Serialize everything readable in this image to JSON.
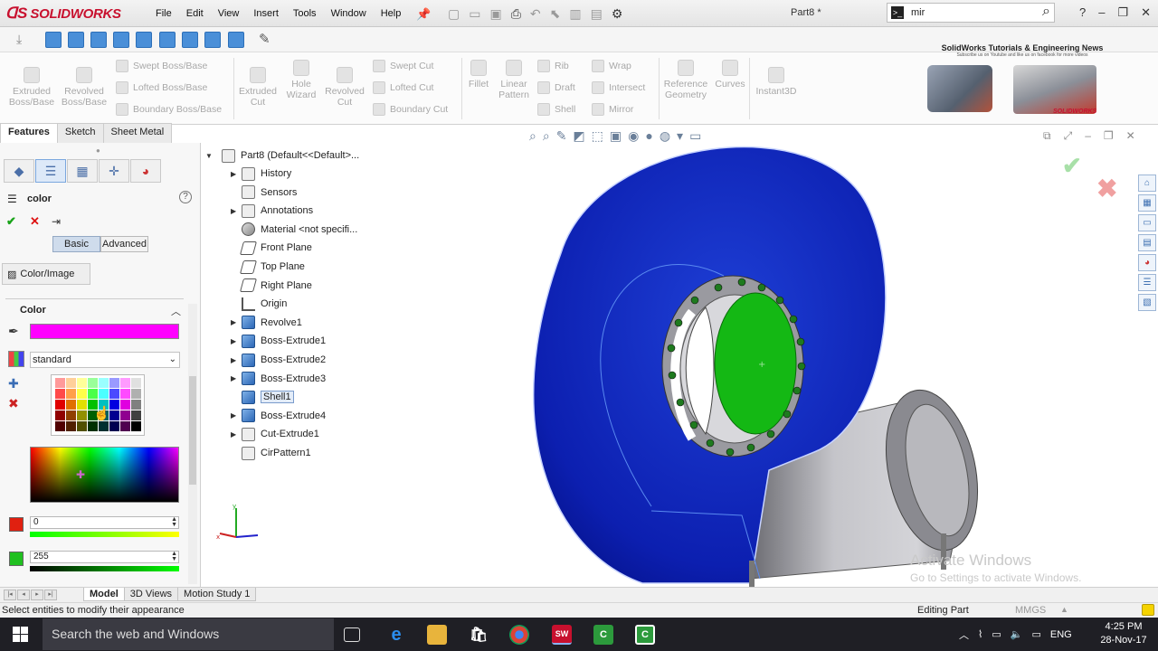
{
  "app": {
    "name": "SOLIDWORKS",
    "doc_title": "Part8 *",
    "menu": [
      "File",
      "Edit",
      "View",
      "Insert",
      "Tools",
      "Window",
      "Help"
    ],
    "search_value": "mir",
    "window_controls": [
      "?",
      "–",
      "❐",
      "✕"
    ]
  },
  "ribbon": {
    "big": [
      "Extruded Boss/Base",
      "Revolved Boss/Base"
    ],
    "boss_list": [
      "Swept Boss/Base",
      "Lofted Boss/Base",
      "Boundary Boss/Base"
    ],
    "cut_big": [
      "Extruded Cut",
      "Hole Wizard",
      "Revolved Cut"
    ],
    "cut_list": [
      "Swept Cut",
      "Lofted Cut",
      "Boundary Cut"
    ],
    "feat_big": [
      "Fillet",
      "Linear Pattern"
    ],
    "feat_list1": [
      "Rib",
      "Draft",
      "Shell"
    ],
    "feat_list2": [
      "Wrap",
      "Intersect",
      "Mirror"
    ],
    "ref": [
      "Reference Geometry",
      "Curves",
      "Instant3D"
    ],
    "news_title": "SolidWorks Tutorials & Engineering News",
    "news_sub": "Subscribe us on Youtube and like us on facebook for more videos",
    "brand_small": "SOLIDWORKS"
  },
  "cmd_tabs": [
    "Features",
    "Sketch",
    "Sheet Metal"
  ],
  "property_manager": {
    "title": "color",
    "modes": [
      "Basic",
      "Advanced"
    ],
    "color_image_tab": "Color/Image",
    "color_group": "Color",
    "selected_color": "#ff00ff",
    "palette": "standard",
    "red_value": "0",
    "green_value": "255"
  },
  "tree": {
    "root": "Part8  (Default<<Default>...",
    "items": [
      "History",
      "Sensors",
      "Annotations",
      "Material <not specifi...",
      "Front Plane",
      "Top Plane",
      "Right Plane",
      "Origin",
      "Revolve1",
      "Boss-Extrude1",
      "Boss-Extrude2",
      "Boss-Extrude3",
      "Shell1",
      "Boss-Extrude4",
      "Cut-Extrude1",
      "CirPattern1"
    ]
  },
  "bottom_tabs": [
    "Model",
    "3D Views",
    "Motion Study 1"
  ],
  "status": {
    "message": "Select entities to modify their appearance",
    "mode": "Editing Part",
    "units": "MMGS"
  },
  "watermark": {
    "title": "Activate Windows",
    "sub": "Go to Settings to activate Windows."
  },
  "taskbar": {
    "search_placeholder": "Search the web and Windows",
    "lang": "ENG",
    "time": "4:25 PM",
    "date": "28-Nov-17"
  }
}
